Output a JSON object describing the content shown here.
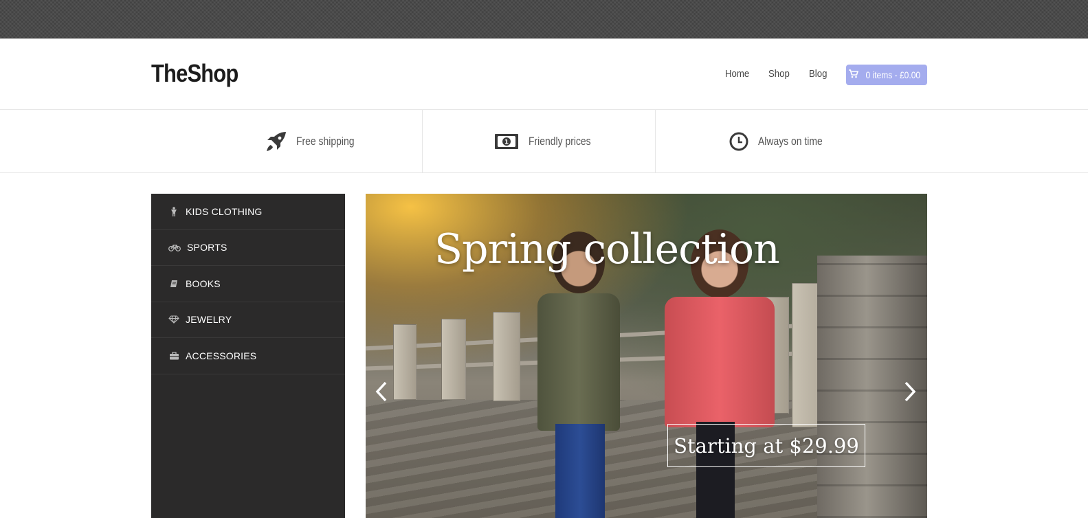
{
  "header": {
    "logo": "TheShop",
    "nav": [
      {
        "label": "Home"
      },
      {
        "label": "Shop"
      },
      {
        "label": "Blog"
      }
    ],
    "cart_label": "0 items - £0.00",
    "cart_color": "#a4acee"
  },
  "features": [
    {
      "label": "Free shipping",
      "icon": "rocket-icon"
    },
    {
      "label": "Friendly prices",
      "icon": "money-icon"
    },
    {
      "label": "Always on time",
      "icon": "clock-icon"
    }
  ],
  "sidebar": {
    "items": [
      {
        "label": "KIDS CLOTHING",
        "icon": "child-icon"
      },
      {
        "label": "SPORTS",
        "icon": "bicycle-icon"
      },
      {
        "label": "BOOKS",
        "icon": "book-icon"
      },
      {
        "label": "JEWELRY",
        "icon": "diamond-icon"
      },
      {
        "label": "ACCESSORIES",
        "icon": "briefcase-icon"
      }
    ],
    "background": "#2b2a2a"
  },
  "hero": {
    "title": "Spring collection",
    "price_label": "Starting at $29.99"
  }
}
